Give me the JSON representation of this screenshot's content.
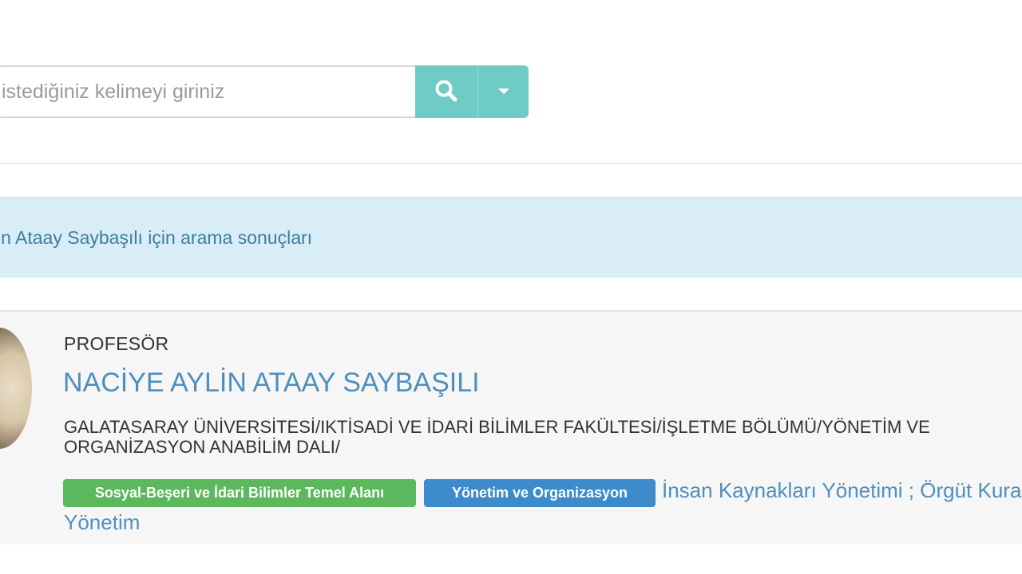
{
  "search": {
    "placeholder": "istediğiniz kelimeyi giriniz",
    "value": "",
    "button_icon": "search-icon",
    "dropdown_icon": "caret-down-icon",
    "accent_color": "#6fcbc6"
  },
  "results_banner": {
    "text": "in Ataay Saybaşılı için arama sonuçları"
  },
  "result": {
    "title": "PROFESÖR",
    "name": "NACİYE AYLİN ATAAY SAYBAŞILI",
    "affiliation": "GALATASARAY ÜNİVERSİTESİ/IKTİSADİ VE İDARİ BİLİMLER FAKÜLTESİ/İŞLETME BÖLÜMÜ/YÖNETİM VE ORGANİZASYON ANABİLİM DALI/",
    "tags": [
      {
        "label": "Sosyal-Beşeri ve İdari Bilimler Temel Alanı",
        "color": "#5cb85c"
      },
      {
        "label": "Yönetim ve Organizasyon",
        "color": "#3d8bcb"
      }
    ],
    "keywords_line1": "İnsan Kaynakları Yönetimi ; Örgüt Kuramı ;",
    "keywords_line2": "Yönetim"
  }
}
